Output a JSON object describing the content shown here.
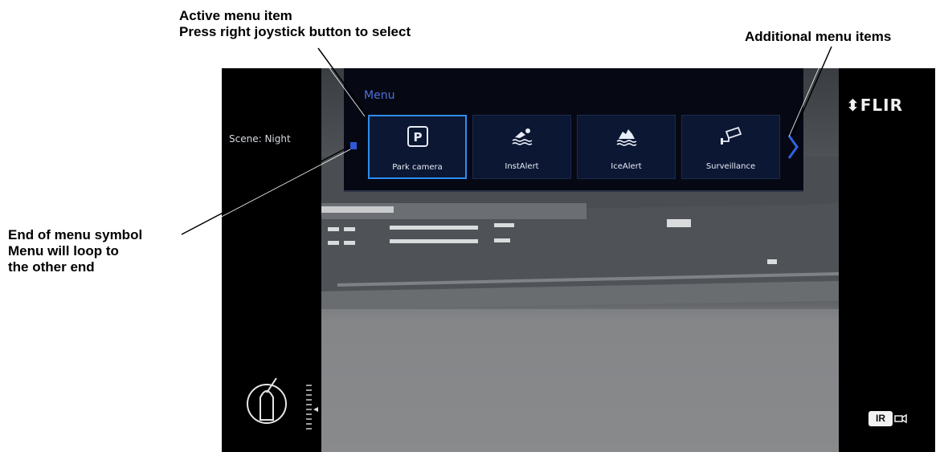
{
  "callouts": {
    "active_line1": "Active menu item",
    "active_line2": "Press right joystick button to select",
    "additional": "Additional menu items",
    "end_line1": "End of menu symbol",
    "end_line2": "Menu will loop to",
    "end_line3": "the other end"
  },
  "menu": {
    "title": "Menu",
    "items": [
      {
        "label": "Park camera",
        "icon": "parking-icon",
        "active": true
      },
      {
        "label": "InstAlert",
        "icon": "swimmer-icon",
        "active": false
      },
      {
        "label": "IceAlert",
        "icon": "iceberg-icon",
        "active": false
      },
      {
        "label": "Surveillance",
        "icon": "security-camera-icon",
        "active": false
      }
    ],
    "accent_color": "#2f8df0"
  },
  "overlay": {
    "scene_label": "Scene: Night",
    "logo": "⬍FLIR",
    "ir_badge": "IR"
  }
}
